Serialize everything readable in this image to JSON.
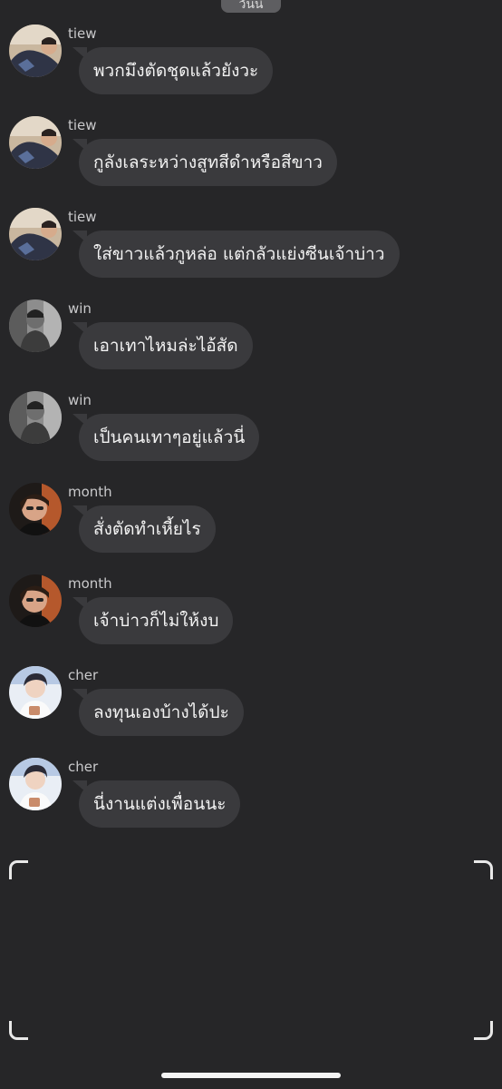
{
  "header": {
    "date_pill": "วันนี้"
  },
  "messages": [
    {
      "sender": "tiew",
      "text": "พวกมึงตัดชุดแล้วยังวะ",
      "avatar": "tiew-avatar"
    },
    {
      "sender": "tiew",
      "text": "กูลังเลระหว่างสูทสีดำหรือสีขาว",
      "avatar": "tiew-avatar"
    },
    {
      "sender": "tiew",
      "text": "ใส่ขาวแล้วกูหล่อ แต่กลัวแย่งซีนเจ้าบ่าว",
      "avatar": "tiew-avatar"
    },
    {
      "sender": "win",
      "text": "เอาเทาไหมล่ะไอ้สัด",
      "avatar": "win-avatar"
    },
    {
      "sender": "win",
      "text": "เป็นคนเทาๆอยู่แล้วนี่",
      "avatar": "win-avatar"
    },
    {
      "sender": "month",
      "text": "สั่งตัดทำเหี้ยไร",
      "avatar": "month-avatar"
    },
    {
      "sender": "month",
      "text": "เจ้าบ่าวก็ไม่ให้งบ",
      "avatar": "month-avatar"
    },
    {
      "sender": "cher",
      "text": "ลงทุนเองบ้างได้ปะ",
      "avatar": "cher-avatar"
    },
    {
      "sender": "cher",
      "text": "นี่งานแต่งเพื่อนนะ",
      "avatar": "cher-avatar"
    }
  ],
  "theme": {
    "background": "#262628",
    "bubble": "#3a3a3d",
    "text": "#f2f2f2",
    "sender_text": "#c9c9cb"
  }
}
